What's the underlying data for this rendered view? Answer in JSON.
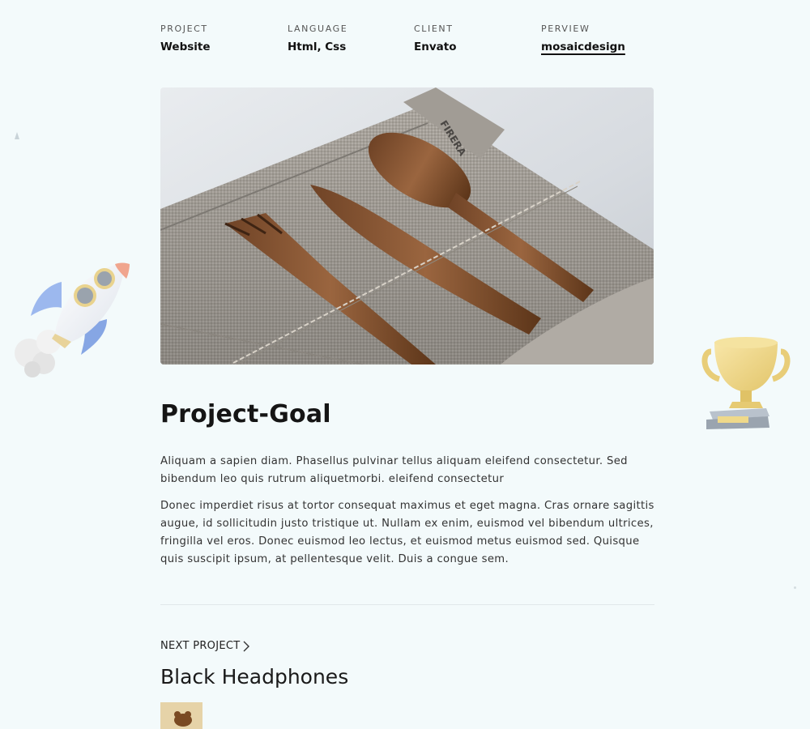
{
  "meta": [
    {
      "label": "PROJECT",
      "value": "Website"
    },
    {
      "label": "LANGUAGE",
      "value": "Html, Css"
    },
    {
      "label": "CLIENT",
      "value": "Envato"
    },
    {
      "label": "PERVIEW",
      "value": "mosaicdesign"
    }
  ],
  "hero": {
    "image": "wooden-cutlery-on-linen",
    "tag_text": "FIRERA"
  },
  "goal": {
    "title": "Project-Goal",
    "paragraph1": "Aliquam a sapien diam. Phasellus pulvinar tellus aliquam eleifend consectetur. Sed bibendum leo quis rutrum aliquetmorbi. eleifend consectetur",
    "paragraph2": "Donec imperdiet risus at tortor consequat maximus et eget magna. Cras ornare sagittis augue, id sollicitudin justo tristique ut. Nullam ex enim, euismod vel bibendum ultrices, fringilla vel eros. Donec euismod leo lectus, et euismod metus euismod sed. Quisque quis suscipit ipsum, at pellentesque velit. Duis a congue sem."
  },
  "next": {
    "label": "NEXT PROJECT",
    "icon": "chevron-right-icon",
    "title": "Black Headphones"
  },
  "decor": {
    "left": "rocket-illustration",
    "right": "trophy-illustration"
  },
  "colors": {
    "background": "#f3fafb",
    "text": "#1b1b1b",
    "divider": "#e1e8ea"
  }
}
